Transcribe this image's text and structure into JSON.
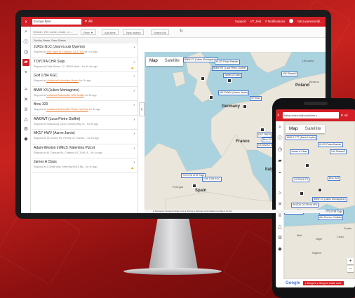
{
  "colors": {
    "brand_red": "#d51f26",
    "map_water": "#aad3df",
    "map_land": "#eae6dc",
    "warning": "#e9a10f"
  },
  "desktop": {
    "header": {
      "menu_icon": "chevron-right-icon",
      "group_select": "Europe fleet",
      "group_all": "▼ All",
      "support": "Support",
      "user_prefix": "VT_test",
      "notifications": "0 Notifications",
      "account": "tutca.pearson@..."
    },
    "rail_icons": [
      "search-icon",
      "info-icon",
      "history-icon",
      "truck-icon",
      "car-icon",
      "route-icon",
      "tools-icon",
      "trophy-icon",
      "alert-icon",
      "settings-icon",
      "pin-icon"
    ],
    "toolbar": {
      "search_placeholder": "Vehicle, VIN, name, mode, or ...",
      "filter": "Filter ▼",
      "add_time": "Add time",
      "trips_history": "Trips history",
      "search_all": "Search All"
    },
    "list": {
      "sort_label": "Sort by Name, Desc  Status",
      "vehicles": [
        {
          "name": "JLR2s GLC (Jean-Louis Quema)",
          "status_prefix": "Stopped at ",
          "location": "10th Saint St, Orlando, CA 17101",
          "status_suffix": " for 4 m ago",
          "warn": false
        },
        {
          "name": "TOYOTA CHR Suijs",
          "status_prefix": "Stopped at Calle Rivera, 12, 28003 Madr... ",
          "location": "",
          "status_suffix": "for 4h 4m ago",
          "warn": true
        },
        {
          "name": "Golf 1784 KGC",
          "status_prefix": "Stopped at ",
          "location": "Vodafone Automotive Madrid",
          "status_suffix": " for 3h ago",
          "warn": false
        },
        {
          "name": "BMW X3 (Julien Montagnino)",
          "status_prefix": "Stopped at ",
          "location": "Vodafone Automotive WW Seattle",
          "status_suffix": " for 6h ago",
          "warn": false
        },
        {
          "name": "Brou 320",
          "status_prefix": "Stopped at ",
          "location": "Vodafone Automotive Rome, Via Tora",
          "status_suffix": " for 4h ago",
          "warn": false
        },
        {
          "name": "AW6/WT (Luca-Pietro Gioffrè)",
          "status_prefix": "Stopped at Strasbourg Court, Victoria Way, B... for 3h ago",
          "location": "",
          "status_suffix": "",
          "warn": false
        },
        {
          "name": "MK17 HWV (Aaron Jarvis)",
          "status_prefix": "Stopped at 141 Dorcy Rd, Henley on Thames... for 4h ago",
          "location": "",
          "status_suffix": "",
          "warn": false
        },
        {
          "name": "Adam-Weston in/MuS (Valentina Pizzo)",
          "status_prefix": "Stopped at 44 Chelsea Rd, Chelsea VIC 3196, A... for 4d ago",
          "location": "",
          "status_suffix": "",
          "warn": false
        },
        {
          "name": "James A Class",
          "status_prefix": "Stopped at 2 Great Way, Kettering NN15 6N... for 4h ago",
          "location": "",
          "status_suffix": "",
          "warn": true
        }
      ]
    },
    "map": {
      "type_map": "Map",
      "type_satellite": "Satellite",
      "place_labels": [
        "North Sea",
        "Germany",
        "France",
        "Spain",
        "Italy",
        "Poland",
        "Belarus",
        "Lithuania",
        "Portugal",
        "Lisbon",
        "Madrid",
        "Paris",
        "Berlin",
        "Rome",
        "Ukraine"
      ],
      "vehicle_labels": [
        "BMW X3 (Julien Montagnino)",
        "KLOS Paula Baeder",
        "BMW MT (Luca Pietro Gioffre)",
        "James A Class",
        "VW Sharan2",
        "MK17HWV (Aaron Jarvis)",
        "VFTest1",
        "DS7 TRIPS",
        "Brou 320",
        "OCTAVIA TS",
        "TOYOTA CHR Suijs",
        "Golf 1784 KGC"
      ],
      "legend": "●  Stopped  ●  Stopped inside zone  ●  Driving  ●  Remote off  ●  Unable to locate  ●  No Fix"
    }
  },
  "phone": {
    "email": "kalia.pearson@vodafone.c...",
    "all": "▼ All",
    "type_map": "Map",
    "type_satellite": "Satellite",
    "vehicle_labels": [
      "MINI 5 FTT (Daniel Joplin)",
      "KLOS Paula Baeder",
      "James A Class",
      "VW Sharan2",
      "OCTAVIA TS",
      "Brou 320",
      "BMW X3 (Julien Montagnino)",
      "SKODA OCTAVIA VFA",
      "Golf 1784 KGC",
      "TOYOTA CHR Suijs",
      "Alfa Romeo Giulietta"
    ],
    "place_labels": [
      "Mali",
      "Niger",
      "Chad",
      "Sudan",
      "Nigeria"
    ],
    "google": "Google",
    "legend_label": "● Stopped  ● Stopped inside zone",
    "zoom_in": "+",
    "zoom_out": "−"
  }
}
